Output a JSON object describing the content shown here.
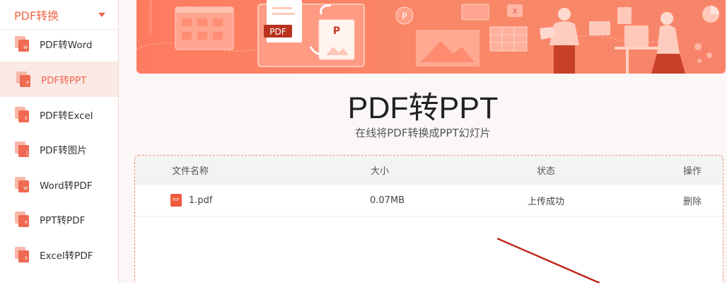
{
  "sidebar": {
    "header_title": "PDF转换",
    "items": [
      {
        "label": "PDF转Word",
        "icon_mark": "W",
        "active": false
      },
      {
        "label": "PDF转PPT",
        "icon_mark": "P",
        "active": true
      },
      {
        "label": "PDF转Excel",
        "icon_mark": "E",
        "active": false
      },
      {
        "label": "PDF转图片",
        "icon_mark": "J",
        "active": false
      },
      {
        "label": "Word转PDF",
        "icon_mark": "W",
        "active": false
      },
      {
        "label": "PPT转PDF",
        "icon_mark": "P",
        "active": false
      },
      {
        "label": "Excel转PDF",
        "icon_mark": "E",
        "active": false
      }
    ]
  },
  "banner": {
    "pdf_badge": "PDF",
    "ppt_badge": "P",
    "circle_badge": "P",
    "x_badge": "X"
  },
  "main": {
    "title": "PDF转PPT",
    "subtitle": "在线将PDF转换成PPT幻灯片"
  },
  "table": {
    "headers": {
      "name": "文件名称",
      "size": "大小",
      "status": "状态",
      "action": "操作"
    },
    "rows": [
      {
        "icon_text": "PDF",
        "name": "1.pdf",
        "size": "0.07MB",
        "status": "上传成功",
        "action": "删除"
      }
    ]
  },
  "colors": {
    "accent": "#f2664a",
    "banner": "#ff7b60",
    "arrow": "#c0281c"
  }
}
